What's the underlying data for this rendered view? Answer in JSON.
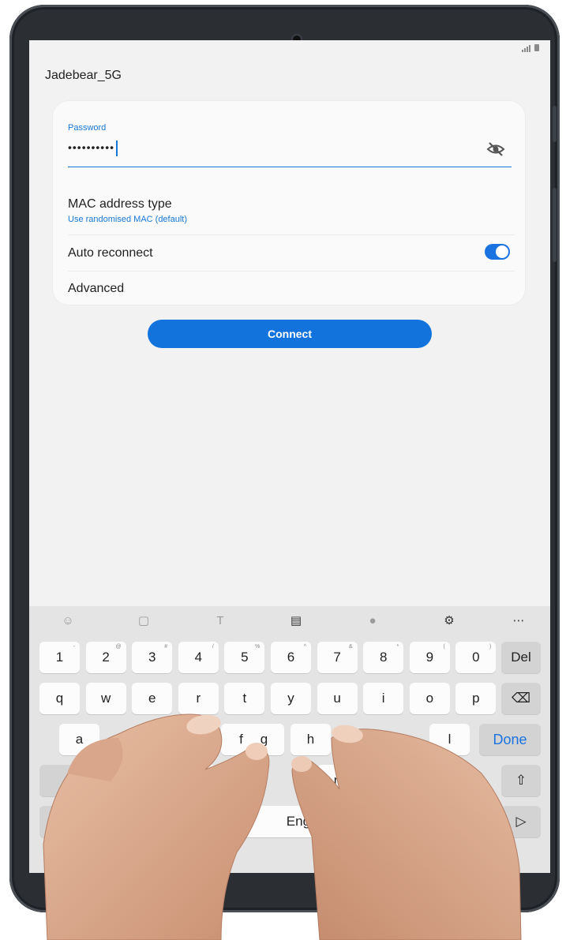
{
  "network": {
    "name": "Jadebear_5G"
  },
  "password": {
    "label": "Password",
    "value": "••••••••••"
  },
  "mac": {
    "title": "MAC address type",
    "subtitle": "Use randomised MAC (default)"
  },
  "auto_reconnect": {
    "label": "Auto reconnect",
    "enabled": true
  },
  "advanced": {
    "label": "Advanced"
  },
  "connect": {
    "label": "Connect"
  },
  "keyboard": {
    "numbers": [
      {
        "k": "1",
        "s": "-"
      },
      {
        "k": "2",
        "s": "@"
      },
      {
        "k": "3",
        "s": "#"
      },
      {
        "k": "4",
        "s": "/"
      },
      {
        "k": "5",
        "s": "%"
      },
      {
        "k": "6",
        "s": "^"
      },
      {
        "k": "7",
        "s": "&"
      },
      {
        "k": "8",
        "s": "*"
      },
      {
        "k": "9",
        "s": "("
      },
      {
        "k": "0",
        "s": ")"
      }
    ],
    "del": "Del",
    "row_q": [
      "q",
      "w",
      "e",
      "r",
      "t",
      "y",
      "u",
      "i",
      "o",
      "p"
    ],
    "row_a": [
      "a",
      "f",
      "g",
      "h",
      "l"
    ],
    "row_z": [
      "c",
      "n"
    ],
    "done": "Done",
    "space": "English (U"
  },
  "colors": {
    "accent": "#1273dc",
    "screen_bg": "#f2f2f2",
    "keyboard_bg": "#e4e4e4"
  }
}
